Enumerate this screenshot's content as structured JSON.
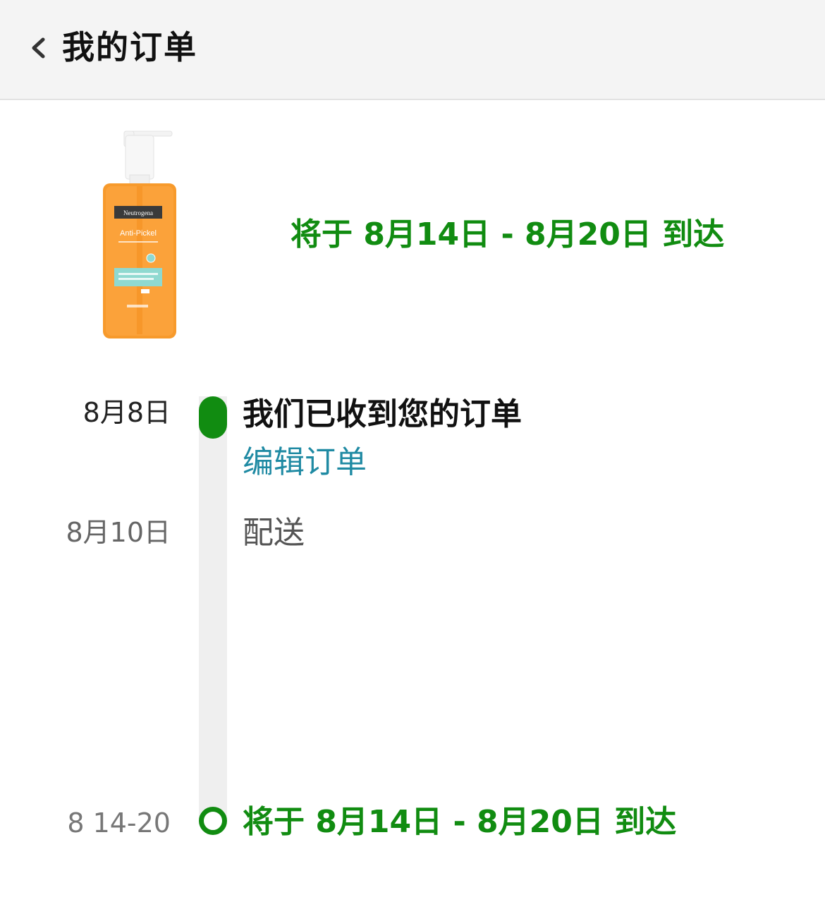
{
  "header": {
    "title": "我的订单",
    "back_icon": "chevron-left-icon"
  },
  "product": {
    "image_icon": "product-bottle-image",
    "brand_text": "Neutrogena",
    "product_text": "Anti-Pickel",
    "eta_banner": "将于 8月14日 - 8月20日 到达"
  },
  "timeline": {
    "events": [
      {
        "date": "8月8日",
        "title": "我们已收到您的订单",
        "link": "编辑订单"
      },
      {
        "date": "8月10日",
        "title": "配送"
      },
      {
        "date": "8 14-20",
        "title": "将于 8月14日 - 8月20日 到达"
      }
    ]
  },
  "colors": {
    "accent_green": "#118c11",
    "link_blue": "#1f8aa3",
    "header_bg": "#f4f4f4",
    "track_gray": "#efefef"
  }
}
